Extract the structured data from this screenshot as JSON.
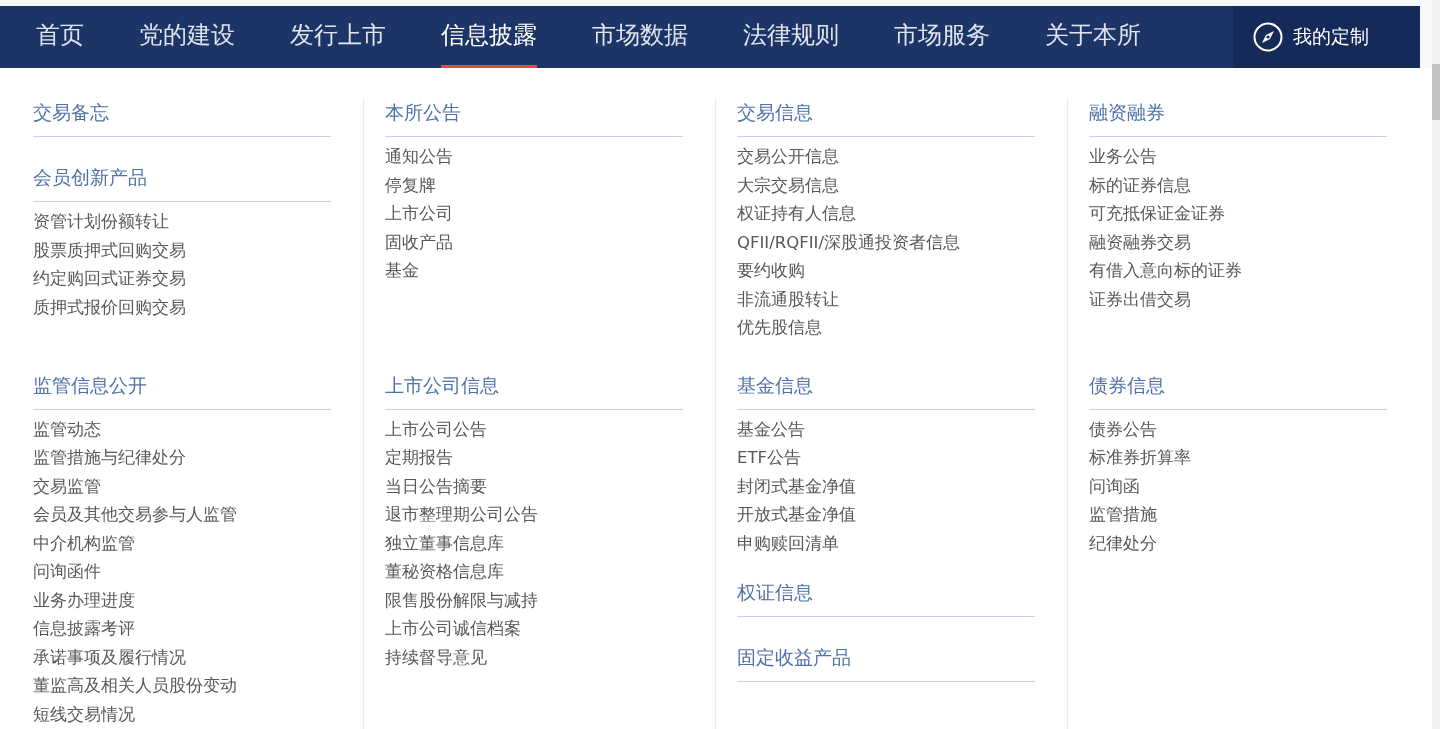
{
  "nav": {
    "tabs": [
      {
        "label": "首页",
        "selected": false
      },
      {
        "label": "党的建设",
        "selected": false
      },
      {
        "label": "发行上市",
        "selected": false
      },
      {
        "label": "信息披露",
        "selected": true
      },
      {
        "label": "市场数据",
        "selected": false
      },
      {
        "label": "法律规则",
        "selected": false
      },
      {
        "label": "市场服务",
        "selected": false
      },
      {
        "label": "关于本所",
        "selected": false
      }
    ],
    "custom_button": {
      "label": "我的定制"
    }
  },
  "menu": {
    "rows": [
      {
        "cells": [
          {
            "sections": [
              {
                "title": "交易备忘"
              },
              {
                "title": "会员创新产品",
                "items": [
                  "资管计划份额转让",
                  "股票质押式回购交易",
                  "约定购回式证券交易",
                  "质押式报价回购交易"
                ]
              }
            ]
          },
          {
            "sections": [
              {
                "title": "本所公告",
                "items": [
                  "通知公告",
                  "停复牌",
                  "上市公司",
                  "固收产品",
                  "基金"
                ]
              }
            ]
          },
          {
            "sections": [
              {
                "title": "交易信息",
                "items": [
                  "交易公开信息",
                  "大宗交易信息",
                  "权证持有人信息",
                  "QFII/RQFII/深股通投资者信息",
                  "要约收购",
                  "非流通股转让",
                  "优先股信息"
                ]
              }
            ]
          },
          {
            "sections": [
              {
                "title": "融资融券",
                "items": [
                  "业务公告",
                  "标的证券信息",
                  "可充抵保证金证券",
                  "融资融券交易",
                  "有借入意向标的证券",
                  "证券出借交易"
                ]
              }
            ]
          }
        ]
      },
      {
        "cells": [
          {
            "sections": [
              {
                "title": "监管信息公开",
                "items": [
                  "监管动态",
                  "监管措施与纪律处分",
                  "交易监管",
                  "会员及其他交易参与人监管",
                  "中介机构监管",
                  "问询函件",
                  "业务办理进度",
                  "信息披露考评",
                  "承诺事项及履行情况",
                  "董监高及相关人员股份变动",
                  "短线交易情况"
                ]
              }
            ]
          },
          {
            "sections": [
              {
                "title": "上市公司信息",
                "items": [
                  "上市公司公告",
                  "定期报告",
                  "当日公告摘要",
                  "退市整理期公司公告",
                  "独立董事信息库",
                  "董秘资格信息库",
                  "限售股份解限与减持",
                  "上市公司诚信档案",
                  "持续督导意见"
                ]
              }
            ]
          },
          {
            "sections": [
              {
                "title": "基金信息",
                "items": [
                  "基金公告",
                  "ETF公告",
                  "封闭式基金净值",
                  "开放式基金净值",
                  "申购赎回清单"
                ]
              },
              {
                "title": "权证信息"
              },
              {
                "title": "固定收益产品"
              }
            ]
          },
          {
            "sections": [
              {
                "title": "债券信息",
                "items": [
                  "债券公告",
                  "标准券折算率",
                  "问询函",
                  "监管措施",
                  "纪律处分"
                ]
              }
            ]
          }
        ]
      }
    ]
  }
}
